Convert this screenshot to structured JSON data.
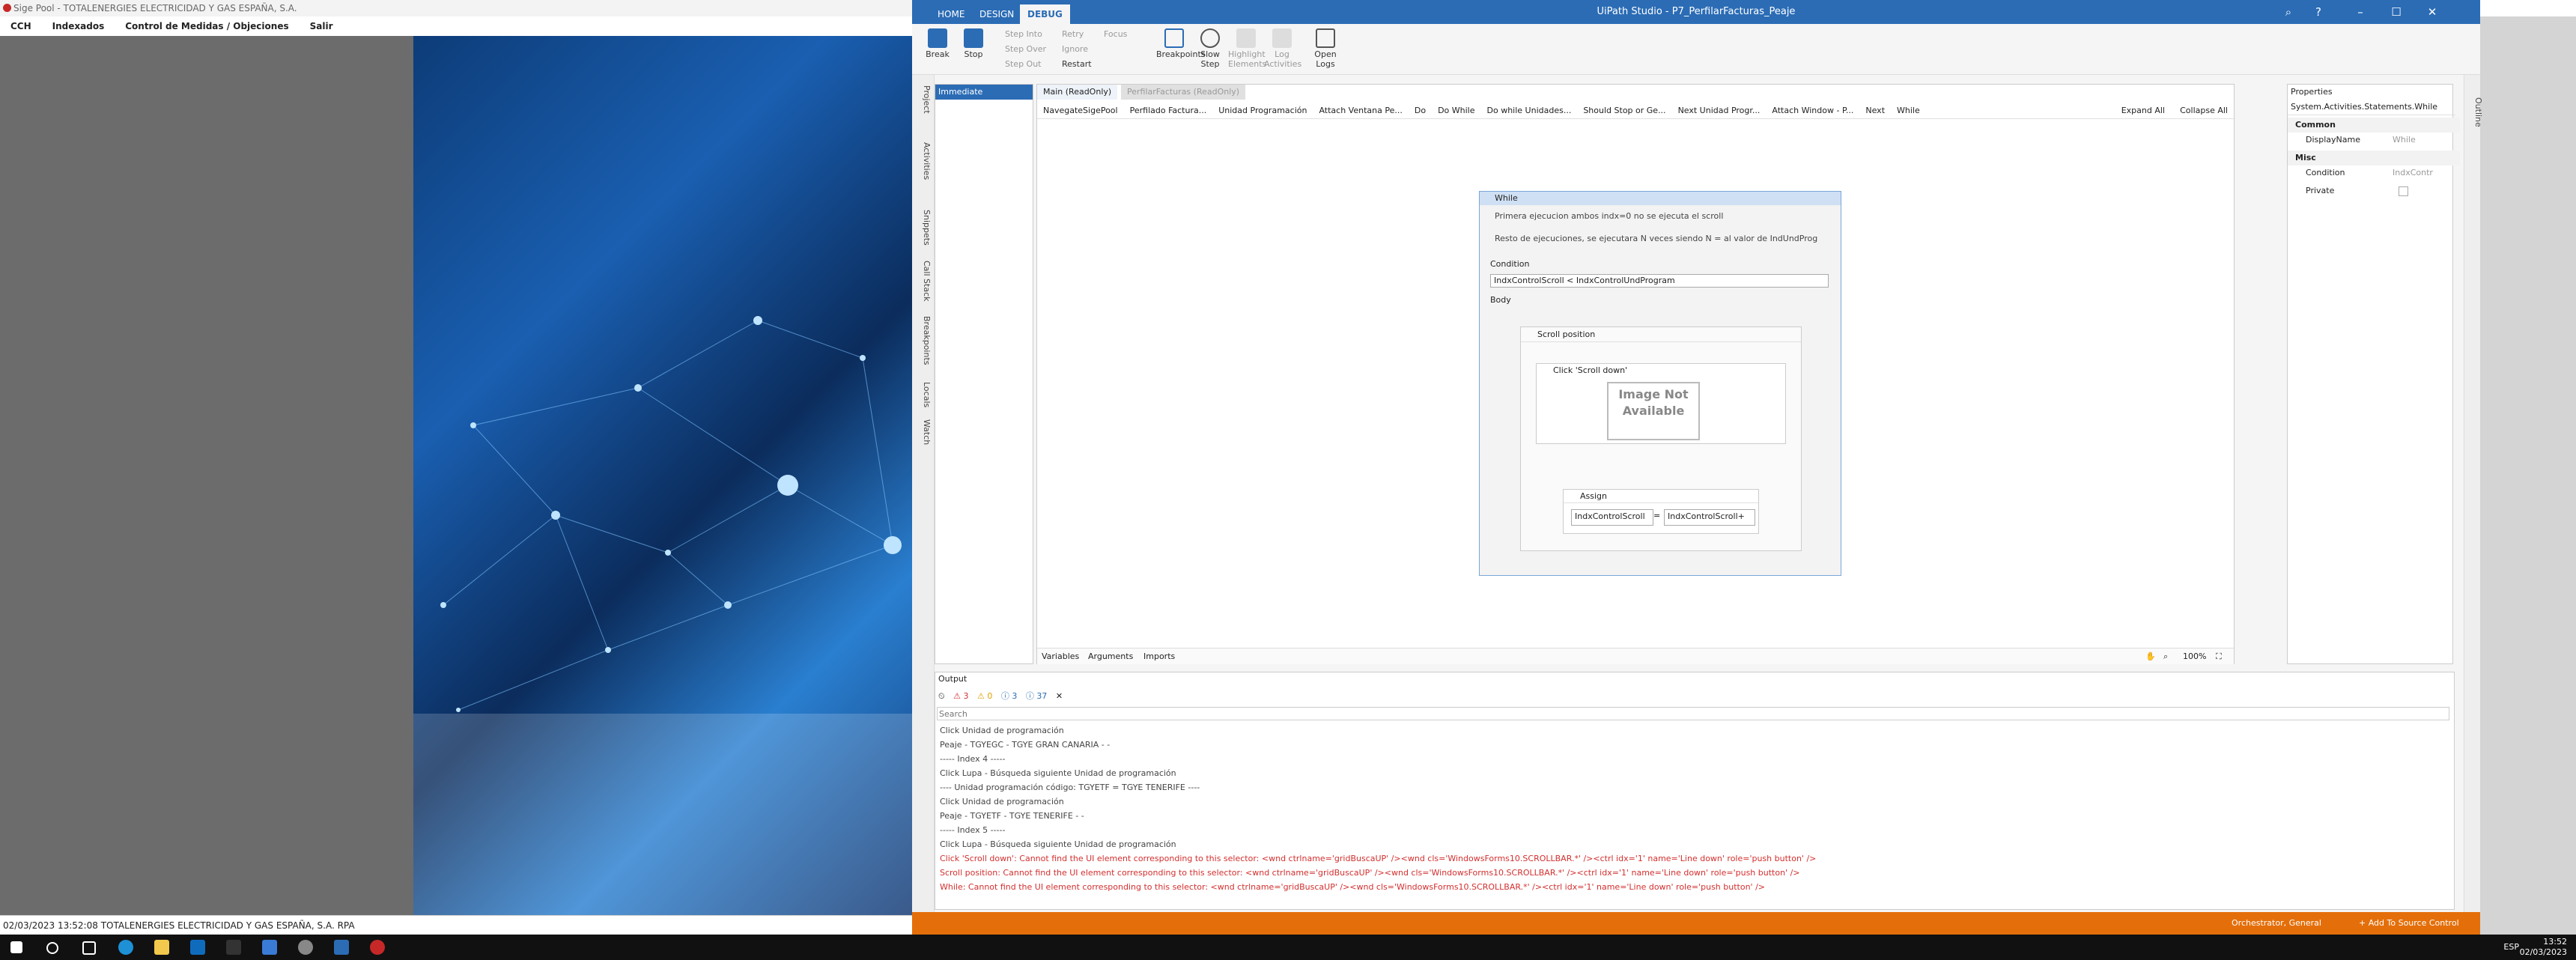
{
  "left_app": {
    "title": "Sige Pool - TOTALENERGIES ELECTRICIDAD Y GAS ESPAÑA, S.A.",
    "menu": [
      "CCH",
      "Indexados",
      "Control de Medidas / Objeciones",
      "Salir"
    ],
    "status": "02/03/2023   13:52:08   TOTALENERGIES ELECTRICIDAD Y GAS ESPAÑA, S.A.   RPA"
  },
  "uipath": {
    "title": "UiPath Studio - P7_PerfilarFacturas_Peaje",
    "tabs": [
      "HOME",
      "DESIGN",
      "DEBUG"
    ],
    "ribbon": {
      "break": "Break",
      "stop": "Stop",
      "step_into": "Step Into",
      "step_over": "Step Over",
      "step_out": "Step Out",
      "retry": "Retry",
      "ignore": "Ignore",
      "restart": "Restart",
      "focus": "Focus",
      "breakpoints": "Breakpoints",
      "slow_step": "Slow Step",
      "highlight": "Highlight Elements",
      "log_activities": "Log Activities",
      "open_logs": "Open Logs"
    },
    "side_tabs": [
      "Project",
      "Activities",
      "Snippets",
      "Call Stack",
      "Breakpoints",
      "Locals",
      "Watch"
    ],
    "immediate": "Immediate",
    "doc_tabs": [
      "Main (ReadOnly)",
      "PerfilarFacturas (ReadOnly)"
    ],
    "breadcrumb": [
      "NavegateSigePool",
      "Perfilado Factura...",
      "Unidad Programación",
      "Attach Ventana Pe...",
      "Do",
      "Do While",
      "Do while Unidades...",
      "Should Stop or Ge...",
      "Next Unidad Progr...",
      "Attach Window - P...",
      "Next",
      "While"
    ],
    "expand_all": "Expand All",
    "collapse_all": "Collapse All",
    "while_activity": {
      "title": "While",
      "note1": "Primera ejecucion ambos indx=0 no se ejecuta el scroll",
      "note2": "Resto de ejecuciones, se ejecutara N veces siendo N = al valor de IndUndProg",
      "condition_label": "Condition",
      "condition": "IndxControlScroll < IndxControlUndProgram",
      "body_label": "Body",
      "scroll_title": "Scroll position",
      "click_title": "Click 'Scroll down'",
      "image_na": "Image Not Available",
      "assign_title": "Assign",
      "assign_to": "IndxControlScroll",
      "assign_eq": "=",
      "assign_value": "IndxControlScroll+"
    },
    "bottom_tabs": [
      "Variables",
      "Arguments",
      "Imports"
    ],
    "zoom": "100%",
    "properties": {
      "title": "Properties",
      "type": "System.Activities.Statements.While",
      "common": "Common",
      "display_name_label": "DisplayName",
      "display_name": "While",
      "misc": "Misc",
      "condition_label": "Condition",
      "condition": "IndxContr",
      "private_label": "Private"
    },
    "outline": "Outline",
    "output": {
      "title": "Output",
      "errors": "3",
      "warnings": "0",
      "info": "3",
      "trace": "37",
      "search_placeholder": "Search",
      "logs": [
        {
          "text": "Click Unidad de programación",
          "err": false
        },
        {
          "text": "Peaje - TGYEGC - TGYE GRAN CANARIA -  -",
          "err": false
        },
        {
          "text": "----- Index 4 -----",
          "err": false
        },
        {
          "text": "Click Lupa - Búsqueda siguiente Unidad de programación",
          "err": false
        },
        {
          "text": "---- Unidad programación código: TGYETF = TGYE TENERIFE ----",
          "err": false
        },
        {
          "text": "Click Unidad de programación",
          "err": false
        },
        {
          "text": "Peaje - TGYETF - TGYE TENERIFE -  -",
          "err": false
        },
        {
          "text": "----- Index 5 -----",
          "err": false
        },
        {
          "text": "Click Lupa - Búsqueda siguiente Unidad de programación",
          "err": false
        },
        {
          "text": "Click 'Scroll down': Cannot find the UI element corresponding to this selector: <wnd ctrlname='gridBuscaUP' /><wnd cls='WindowsForms10.SCROLLBAR.*' /><ctrl idx='1' name='Line down' role='push button' />",
          "err": true
        },
        {
          "text": "Scroll position: Cannot find the UI element corresponding to this selector: <wnd ctrlname='gridBuscaUP' /><wnd cls='WindowsForms10.SCROLLBAR.*' /><ctrl idx='1' name='Line down' role='push button' />",
          "err": true
        },
        {
          "text": "While: Cannot find the UI element corresponding to this selector: <wnd ctrlname='gridBuscaUP' /><wnd cls='WindowsForms10.SCROLLBAR.*' /><ctrl idx='1' name='Line down' role='push button' />",
          "err": true
        }
      ]
    },
    "status_orchestrator": "Orchestrator, General",
    "status_source": "+ Add To Source Control"
  },
  "taskbar": {
    "time": "13:52",
    "date": "02/03/2023",
    "lang": "ESP"
  }
}
